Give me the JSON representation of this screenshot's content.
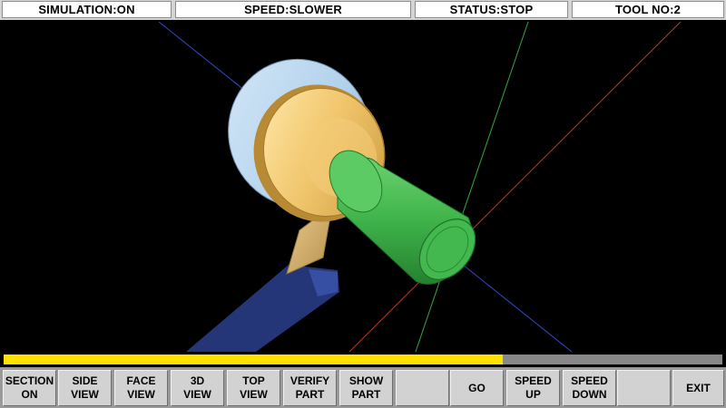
{
  "status": {
    "simulation": "SIMULATION:ON",
    "speed": "SPEED:SLOWER",
    "state": "STATUS:STOP",
    "tool": "TOOL NO:2"
  },
  "progress": {
    "fraction": 0.695
  },
  "toolbar": {
    "section": {
      "line1": "SECTION",
      "line2": "ON"
    },
    "side_view": {
      "line1": "SIDE",
      "line2": "VIEW"
    },
    "face_view": {
      "line1": "FACE",
      "line2": "VIEW"
    },
    "view_3d": {
      "line1": "3D",
      "line2": "VIEW"
    },
    "top_view": {
      "line1": "TOP",
      "line2": "VIEW"
    },
    "verify_part": {
      "line1": "VERIFY",
      "line2": "PART"
    },
    "show_part": {
      "line1": "SHOW",
      "line2": "PART"
    },
    "blank1": "",
    "go": "GO",
    "speed_up": {
      "line1": "SPEED",
      "line2": "UP"
    },
    "speed_down": {
      "line1": "SPEED",
      "line2": "DOWN"
    },
    "blank2": "",
    "exit": "EXIT"
  },
  "colors": {
    "chuck_body": "#b9d7f0",
    "chuck_face": "#efc870",
    "workpiece": "#3fb34a",
    "tool": "#d9b470",
    "tool_holder": "#2a3f8c",
    "progress_fill": "#ffe100",
    "progress_track": "#888888",
    "axis_x": "#e0302a",
    "axis_y": "#2ea84a",
    "axis_z": "#3048c8"
  }
}
